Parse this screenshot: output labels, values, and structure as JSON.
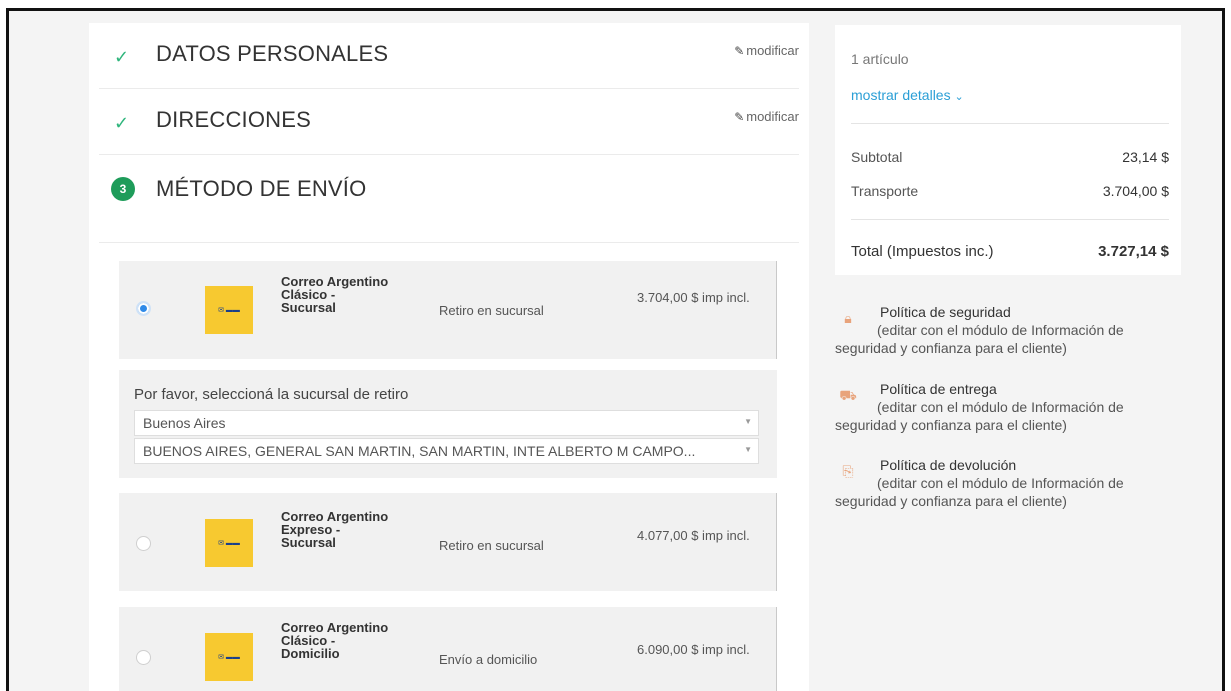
{
  "steps": {
    "personal": {
      "title": "DATOS PERSONALES",
      "edit": "modificar"
    },
    "addresses": {
      "title": "DIRECCIONES",
      "edit": "modificar"
    },
    "shipping": {
      "number": "3",
      "title": "MÉTODO DE ENVÍO"
    }
  },
  "carriers": [
    {
      "name": "Correo Argentino Clásico - Sucursal",
      "type": "Retiro en sucursal",
      "price": "3.704,00 $ imp incl.",
      "selected": true
    },
    {
      "name": "Correo Argentino Expreso - Sucursal",
      "type": "Retiro en sucursal",
      "price": "4.077,00 $ imp incl.",
      "selected": false
    },
    {
      "name": "Correo Argentino Clásico - Domicilio",
      "type": "Envío a domicilio",
      "price": "6.090,00 $ imp incl.",
      "selected": false
    }
  ],
  "branch": {
    "label": "Por favor, seleccioná la sucursal de retiro",
    "province": "Buenos Aires",
    "branch": "BUENOS AIRES, GENERAL SAN MARTIN, SAN MARTIN, INTE ALBERTO M CAMPO..."
  },
  "cart": {
    "articles": "1 artículo",
    "show_details": "mostrar detalles",
    "subtotal_label": "Subtotal",
    "subtotal_value": "23,14 $",
    "shipping_label": "Transporte",
    "shipping_value": "3.704,00 $",
    "total_label": "Total (Impuestos inc.)",
    "total_value": "3.727,14 $"
  },
  "reassurance": [
    {
      "icon": "lock-icon",
      "title": "Política de seguridad",
      "desc": "(editar con el módulo de Información de seguridad y confianza para el cliente)"
    },
    {
      "icon": "truck-icon",
      "title": "Política de entrega",
      "desc": "(editar con el módulo de Información de seguridad y confianza para el cliente)"
    },
    {
      "icon": "return-icon",
      "title": "Política de devolución",
      "desc": "(editar con el módulo de Información de seguridad y confianza para el cliente)"
    }
  ],
  "colors": {
    "accent": "#2b9fd6",
    "success": "#1e9c5a",
    "logo_yellow": "#f7c930",
    "radio_selected": "#2f8ae8"
  }
}
